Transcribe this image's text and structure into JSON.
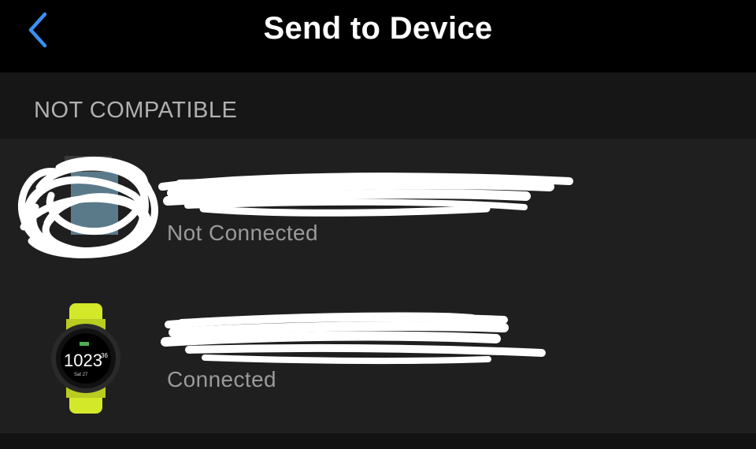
{
  "nav": {
    "title": "Send to Device",
    "back_icon": "chevron-left-icon",
    "accent_color": "#3b8ff2"
  },
  "section": {
    "header": "NOT COMPATIBLE"
  },
  "devices": [
    {
      "status": "Not Connected",
      "name_redacted": true,
      "image_redacted": true
    },
    {
      "status": "Connected",
      "name_redacted": true,
      "watch_time": "1023",
      "watch_seconds": "36",
      "watch_date": "Sat 27",
      "band_color": "#d4e82a"
    }
  ]
}
